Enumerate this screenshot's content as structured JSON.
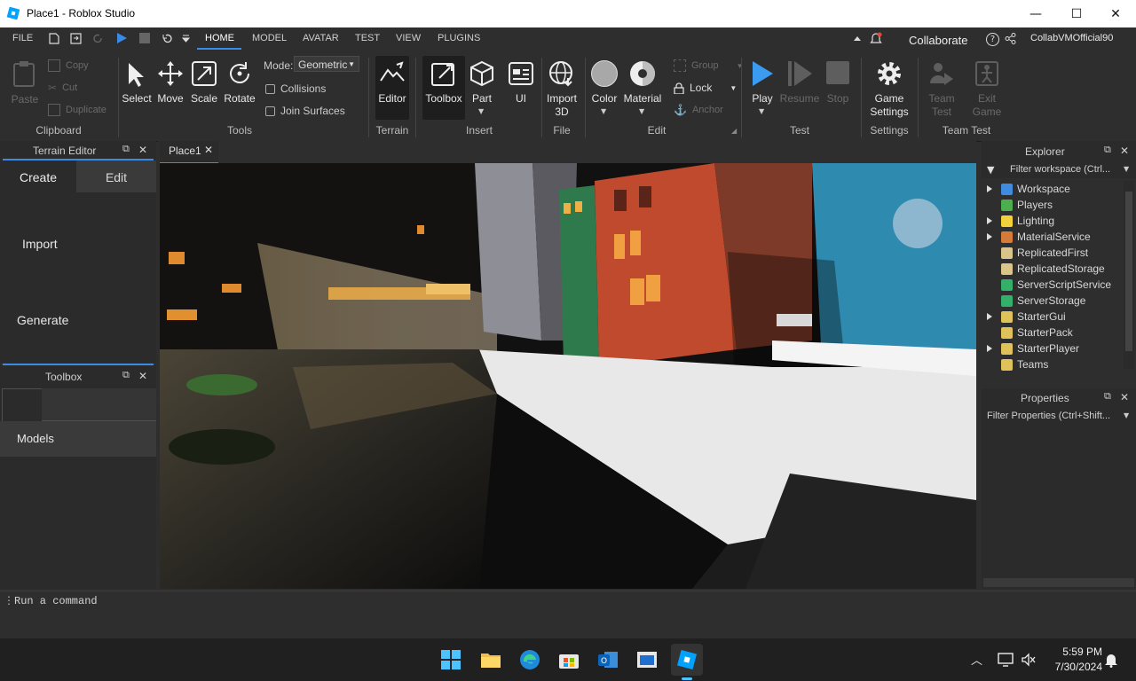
{
  "window": {
    "title": "Place1 - Roblox Studio",
    "minimize": "—",
    "maximize": "☐",
    "close": "✕"
  },
  "menubar": {
    "file": "FILE",
    "tabs": [
      "HOME",
      "MODEL",
      "AVATAR",
      "TEST",
      "VIEW",
      "PLUGINS"
    ],
    "active_tab": "HOME",
    "collaborate": "Collaborate",
    "username": "CollabVMOfficial90",
    "help": "?"
  },
  "ribbon": {
    "clipboard": {
      "paste": "Paste",
      "copy": "Copy",
      "cut": "Cut",
      "duplicate": "Duplicate",
      "group": "Clipboard"
    },
    "tools": {
      "select": "Select",
      "move": "Move",
      "scale": "Scale",
      "rotate": "Rotate",
      "mode_label": "Mode:",
      "mode_value": "Geometric",
      "collisions": "Collisions",
      "join_surfaces": "Join Surfaces",
      "group": "Tools"
    },
    "terrain": {
      "editor": "Editor",
      "group": "Terrain"
    },
    "insert": {
      "toolbox": "Toolbox",
      "part": "Part",
      "ui": "UI",
      "group": "Insert"
    },
    "file": {
      "import_line1": "Import",
      "import_line2": "3D",
      "group": "File"
    },
    "edit": {
      "color": "Color",
      "material": "Material",
      "group_btn": "Group",
      "lock": "Lock",
      "anchor": "Anchor",
      "group": "Edit"
    },
    "test": {
      "play": "Play",
      "resume": "Resume",
      "stop": "Stop",
      "group": "Test"
    },
    "settings": {
      "line1": "Game",
      "line2": "Settings",
      "group": "Settings"
    },
    "teamtest": {
      "team_line1": "Team",
      "team_line2": "Test",
      "exit_line1": "Exit",
      "exit_line2": "Game",
      "group": "Team Test"
    }
  },
  "terrain_editor": {
    "title": "Terrain Editor",
    "tabs": [
      "Create",
      "Edit"
    ],
    "items": [
      "Import",
      "Generate"
    ]
  },
  "toolbox": {
    "title": "Toolbox",
    "models": "Models"
  },
  "viewport": {
    "tab": "Place1"
  },
  "explorer": {
    "title": "Explorer",
    "filter_placeholder": "Filter workspace (Ctrl...",
    "items": [
      {
        "label": "Workspace",
        "expandable": true,
        "color": "#3f8be0"
      },
      {
        "label": "Players",
        "expandable": false,
        "color": "#4cae4c"
      },
      {
        "label": "Lighting",
        "expandable": true,
        "color": "#f2d13a"
      },
      {
        "label": "MaterialService",
        "expandable": true,
        "color": "#d67a3a"
      },
      {
        "label": "ReplicatedFirst",
        "expandable": false,
        "color": "#d9c48a"
      },
      {
        "label": "ReplicatedStorage",
        "expandable": false,
        "color": "#d9c48a"
      },
      {
        "label": "ServerScriptService",
        "expandable": false,
        "color": "#33b06a"
      },
      {
        "label": "ServerStorage",
        "expandable": false,
        "color": "#33b06a"
      },
      {
        "label": "StarterGui",
        "expandable": true,
        "color": "#e0c25a"
      },
      {
        "label": "StarterPack",
        "expandable": false,
        "color": "#e0c25a"
      },
      {
        "label": "StarterPlayer",
        "expandable": true,
        "color": "#e0c25a"
      },
      {
        "label": "Teams",
        "expandable": false,
        "color": "#e0c25a"
      }
    ]
  },
  "properties": {
    "title": "Properties",
    "filter_placeholder": "Filter Properties (Ctrl+Shift..."
  },
  "command_bar": {
    "placeholder": "Run a command"
  },
  "taskbar": {
    "time": "5:59 PM",
    "date": "7/30/2024"
  }
}
